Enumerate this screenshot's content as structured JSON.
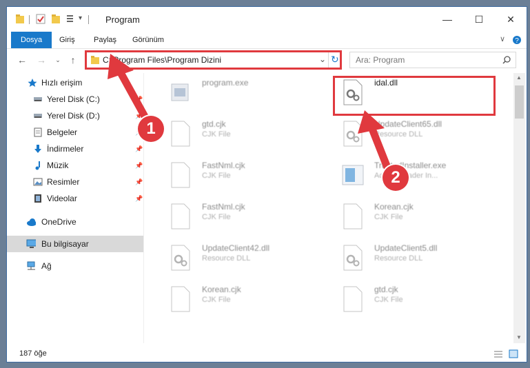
{
  "window": {
    "title": "Program",
    "controls": {
      "minimize": "—",
      "maximize": "☐",
      "close": "✕"
    }
  },
  "ribbon": {
    "tabs": [
      "Dosya",
      "Giriş",
      "Paylaş",
      "Görünüm"
    ],
    "expand_icon": "chevron-down-icon",
    "help_icon": "help-icon"
  },
  "nav": {
    "address": "C:\\Program Files\\Program Dizini",
    "search_placeholder": "Ara: Program"
  },
  "sidebar": {
    "items": [
      {
        "label": "Hızlı erişim",
        "icon": "star-icon",
        "pinned": false
      },
      {
        "label": "Yerel Disk (C:)",
        "icon": "drive-icon",
        "pinned": true
      },
      {
        "label": "Yerel Disk (D:)",
        "icon": "drive-icon",
        "pinned": true
      },
      {
        "label": "Belgeler",
        "icon": "documents-icon",
        "pinned": true
      },
      {
        "label": "İndirmeler",
        "icon": "download-icon",
        "pinned": true
      },
      {
        "label": "Müzik",
        "icon": "music-icon",
        "pinned": true
      },
      {
        "label": "Resimler",
        "icon": "pictures-icon",
        "pinned": true
      },
      {
        "label": "Videolar",
        "icon": "videos-icon",
        "pinned": true
      },
      {
        "label": "OneDrive",
        "icon": "cloud-icon",
        "pinned": false
      },
      {
        "label": "Bu bilgisayar",
        "icon": "computer-icon",
        "pinned": false,
        "selected": true
      },
      {
        "label": "Ağ",
        "icon": "network-icon",
        "pinned": false
      }
    ]
  },
  "files": [
    {
      "name": "program.exe",
      "type": "",
      "icon": "exe-icon"
    },
    {
      "name": "idal.dll",
      "type": "",
      "icon": "dll-icon"
    },
    {
      "name": "gtd.cjk",
      "type": "CJK File",
      "icon": "file-icon"
    },
    {
      "name": "UpdateClient65.dll",
      "type": "Resource DLL",
      "icon": "dll-icon"
    },
    {
      "name": "FastNml.cjk",
      "type": "CJK File",
      "icon": "file-icon"
    },
    {
      "name": "TrustedInstaller.exe",
      "type": "Adobe Reader In...",
      "icon": "installer-icon"
    },
    {
      "name": "FastNml.cjk",
      "type": "CJK File",
      "icon": "file-icon"
    },
    {
      "name": "Korean.cjk",
      "type": "CJK File",
      "icon": "file-icon"
    },
    {
      "name": "UpdateClient42.dll",
      "type": "Resource DLL",
      "icon": "dll-icon"
    },
    {
      "name": "UpdateClient5.dll",
      "type": "Resource DLL",
      "icon": "dll-icon"
    },
    {
      "name": "Korean.cjk",
      "type": "CJK File",
      "icon": "file-icon"
    },
    {
      "name": "gtd.cjk",
      "type": "CJK File",
      "icon": "file-icon"
    }
  ],
  "status": {
    "count": "187 öğe"
  },
  "annotations": {
    "step1": "1",
    "step2": "2",
    "color": "#e0393e"
  }
}
